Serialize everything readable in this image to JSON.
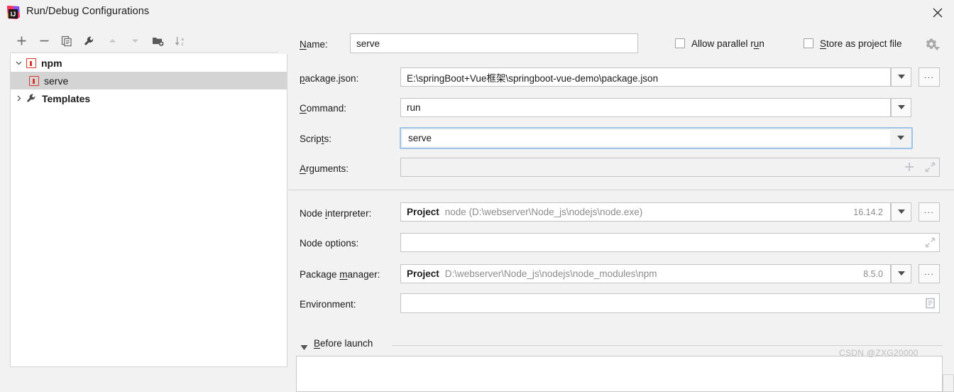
{
  "window": {
    "title": "Run/Debug Configurations",
    "logo_icon": "intellij-idea-logo",
    "close_icon": "close-icon"
  },
  "toolbar": {
    "buttons": [
      {
        "name": "add-configuration",
        "icon": "plus-icon",
        "enabled": true
      },
      {
        "name": "remove-configuration",
        "icon": "minus-icon",
        "enabled": true
      },
      {
        "name": "copy-configuration",
        "icon": "copy-icon",
        "enabled": true
      },
      {
        "name": "edit-templates",
        "icon": "wrench-icon",
        "enabled": true
      },
      {
        "name": "move-up",
        "icon": "arrow-up-icon",
        "enabled": false
      },
      {
        "name": "move-down",
        "icon": "arrow-down-icon",
        "enabled": false
      },
      {
        "name": "new-folder",
        "icon": "folder-add-icon",
        "enabled": true
      },
      {
        "name": "sort-alphabetically",
        "icon": "sort-az-icon",
        "enabled": true
      }
    ]
  },
  "tree": {
    "nodes": [
      {
        "label": "npm",
        "icon": "npm-icon",
        "expanded": true,
        "bold": true,
        "selected": false,
        "level": 0
      },
      {
        "label": "serve",
        "icon": "npm-icon",
        "bold": false,
        "selected": true,
        "level": 1
      },
      {
        "label": "Templates",
        "icon": "wrench-icon",
        "expanded": false,
        "bold": true,
        "selected": false,
        "level": 0
      }
    ]
  },
  "form": {
    "name": {
      "label": "Name:",
      "label_mnemonic": "N",
      "label_rest": "ame:",
      "value": "serve"
    },
    "allow_parallel_run": {
      "label_pre": "Allow parallel r",
      "label_mnemonic": "u",
      "label_post": "n",
      "checked": false
    },
    "store_as_project_file": {
      "label_mnemonic": "S",
      "label_post": "tore as project file",
      "checked": false,
      "gear_icon": "gear-dropdown-icon"
    },
    "package_json": {
      "label_mnemonic": "p",
      "label_post": "ackage.json:",
      "value": "E:\\springBoot+Vue框架\\springboot-vue-demo\\package.json",
      "dropdown_icon": "chevron-down-icon",
      "browse_label": "..."
    },
    "command": {
      "label_mnemonic": "C",
      "label_post": "ommand:",
      "value": "run",
      "dropdown_icon": "chevron-down-icon"
    },
    "scripts": {
      "label_pre": "Scrip",
      "label_mnemonic": "t",
      "label_post": "s:",
      "value": "serve",
      "focused": true,
      "dropdown_icon": "chevron-down-icon"
    },
    "arguments": {
      "label_mnemonic": "A",
      "label_post": "rguments:",
      "value": "",
      "add_icon": "plus-icon",
      "expand_icon": "expand-icon"
    },
    "node_interpreter": {
      "label_pre": "Node ",
      "label_mnemonic": "i",
      "label_post": "nterpreter:",
      "scope": "Project",
      "value": "node (D:\\webserver\\Node_js\\nodejs\\node.exe)",
      "version": "16.14.2",
      "dropdown_icon": "chevron-down-icon",
      "browse_label": "..."
    },
    "node_options": {
      "label": "Node options:",
      "value": "",
      "expand_icon": "expand-icon"
    },
    "package_manager": {
      "label_pre": "Package ",
      "label_mnemonic": "m",
      "label_post": "anager:",
      "scope": "Project",
      "value": "D:\\webserver\\Node_js\\nodejs\\node_modules\\npm",
      "version": "8.5.0",
      "dropdown_icon": "chevron-down-icon",
      "browse_label": "..."
    },
    "environment": {
      "label": "Environment:",
      "value": "",
      "editor_icon": "environment-variables-icon"
    },
    "before_launch": {
      "label_mnemonic": "B",
      "label_post": "efore launch",
      "expanded": true,
      "collapse_icon": "triangle-down-icon"
    }
  },
  "watermark": {
    "text": "CSDN @ZXG20000"
  },
  "colors": {
    "accent_focus": "#9ec5e8",
    "npm_red": "#d9392c",
    "selection_gray": "#d4d4d4",
    "panel_bg": "#f2f2f2",
    "field_bg": "#ffffff",
    "muted_text": "#8c8c8c"
  }
}
